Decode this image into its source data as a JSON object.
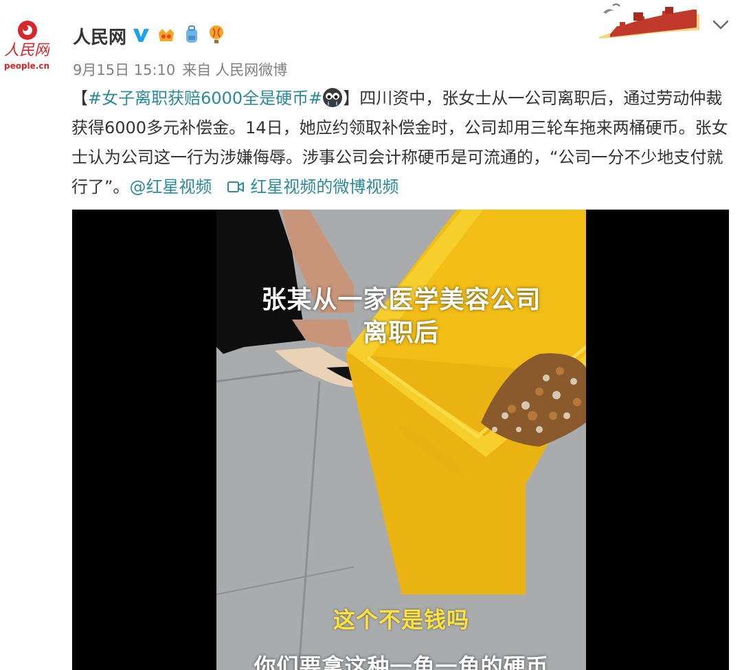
{
  "post": {
    "username": "人民网",
    "avatar_text": "人民网",
    "avatar_sub": "people.cn",
    "date": "9月15日 15:10",
    "via": "来自",
    "source": "人民网微博",
    "bracket_open": "【",
    "hashtag": "#女子离职获赔6000全是硬币#",
    "bracket_close": "】",
    "body": "四川资中，张女士从一公司离职后，通过劳动仲裁获得6000多元补偿金。14日，她应约领取补偿金时，公司却用三轮车拖来两桶硬币。张女士认为公司这一行为涉嫌侮辱。涉事公司会计称硬币是可流通的，“公司一分不少地支付就行了”。",
    "mention": "@红星视频",
    "video_link": "红星视频的微博视频"
  },
  "icons": {
    "verified": "verified-v-icon",
    "crown": "crown-badge-icon",
    "bag": "backpack-badge-icon",
    "balloon": "balloon-badge-icon",
    "chevron": "chevron-down-icon",
    "video": "video-camera-icon",
    "emoji": "crying-emoji-icon"
  },
  "video": {
    "caption_top_line1": "张某从一家医学美容公司",
    "caption_top_line2": "离职后",
    "caption_mid": "这个不是钱吗",
    "caption_bottom": "你们要拿这种一角一角的硬币"
  },
  "colors": {
    "link": "#2b8a9a",
    "meta": "#808080",
    "text": "#333333",
    "verified": "#1da1f2",
    "bucket": "#f5c21a"
  }
}
